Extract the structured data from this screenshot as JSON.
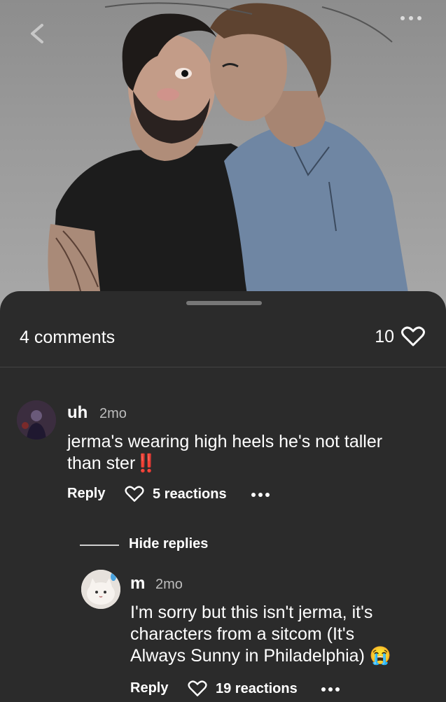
{
  "post": {
    "image_alt": "drawing of two men, one with a beard in a black tank top, one in a blue shirt",
    "back_icon": "chevron-left-icon",
    "more_icon": "more-dots-icon"
  },
  "comments_header": {
    "count_label": "4 comments",
    "likes_count": "10",
    "heart_icon": "heart-outline-icon"
  },
  "comments": [
    {
      "username": "uh",
      "time": "2mo",
      "text": "jerma's wearing high heels he's not taller than ster",
      "emoji": "‼️",
      "reply_label": "Reply",
      "reactions_label": "5 reactions"
    }
  ],
  "replies_toggle": "Hide replies",
  "replies": [
    {
      "username": "m",
      "time": "2mo",
      "text_line1": "I'm sorry but this isn't jerma, it's",
      "text_line2": "characters from a sitcom (It's",
      "text_line3": "Always Sunny in Philadelphia)",
      "emoji": "😭",
      "reply_label": "Reply",
      "reactions_label": "19 reactions"
    }
  ],
  "colors": {
    "background": "#2b2b2b",
    "accent_red": "#e53935",
    "divider": "#444444"
  }
}
